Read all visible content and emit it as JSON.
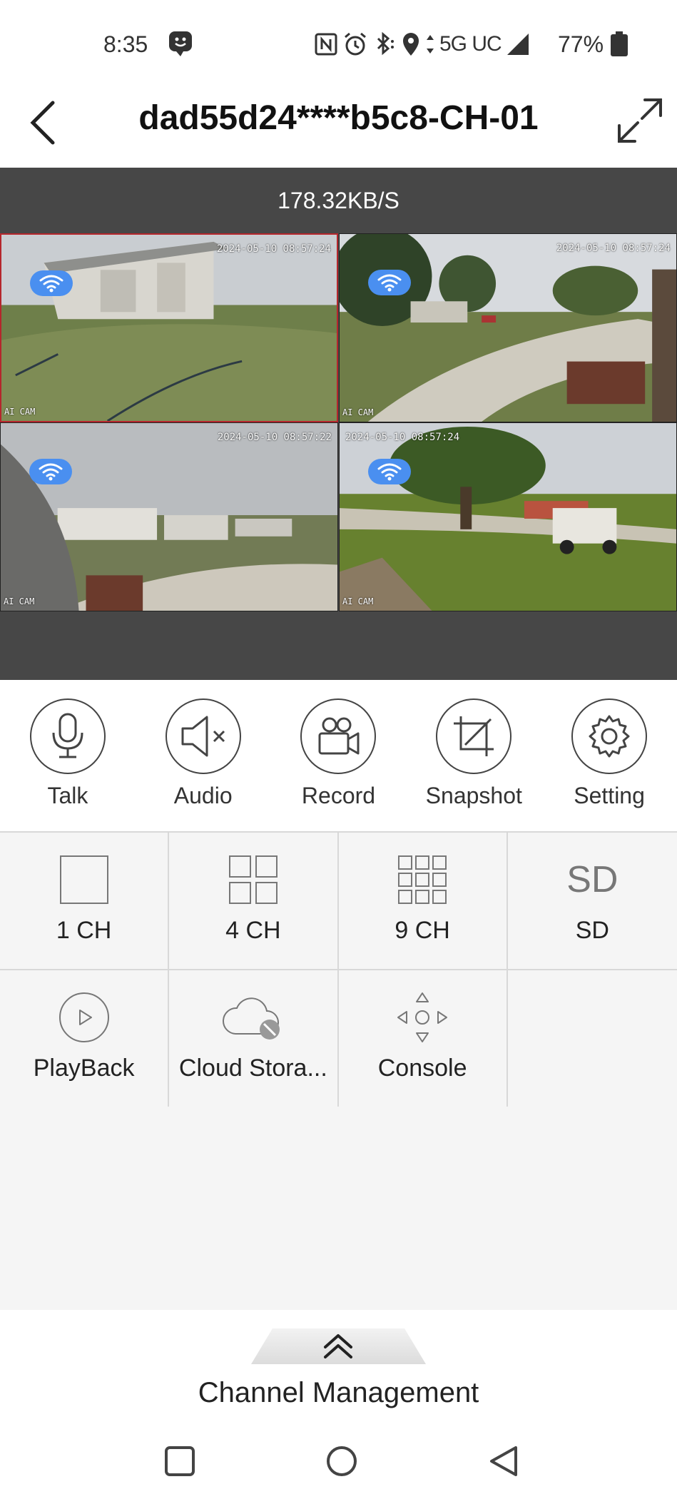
{
  "status_bar": {
    "time": "8:35",
    "carrier": "5G UC",
    "battery": "77%"
  },
  "header": {
    "title": "dad55d24****b5c8-CH-01"
  },
  "video": {
    "bitrate": "178.32KB/S",
    "cameras": [
      {
        "timestamp": "2024-05-10 08:57:24",
        "label": "AI CAM",
        "active": true
      },
      {
        "timestamp": "2024-05-10 08:57:24",
        "label": "AI CAM",
        "active": false
      },
      {
        "timestamp": "2024-05-10 08:57:22",
        "label": "AI CAM",
        "active": false
      },
      {
        "timestamp": "2024-05-10 08:57:24",
        "label": "AI CAM",
        "active": false
      }
    ]
  },
  "controls": {
    "talk": "Talk",
    "audio": "Audio",
    "record": "Record",
    "snapshot": "Snapshot",
    "setting": "Setting"
  },
  "menu": {
    "ch1": "1 CH",
    "ch4": "4 CH",
    "ch9": "9 CH",
    "sd_icon": "SD",
    "sd": "SD",
    "playback": "PlayBack",
    "cloud": "Cloud Stora...",
    "console": "Console"
  },
  "channel_management": "Channel Management",
  "colors": {
    "video_bg": "#474747",
    "active_border": "#b5262c",
    "wifi_badge": "#4a8ff0",
    "menu_bg": "#f5f5f5"
  }
}
